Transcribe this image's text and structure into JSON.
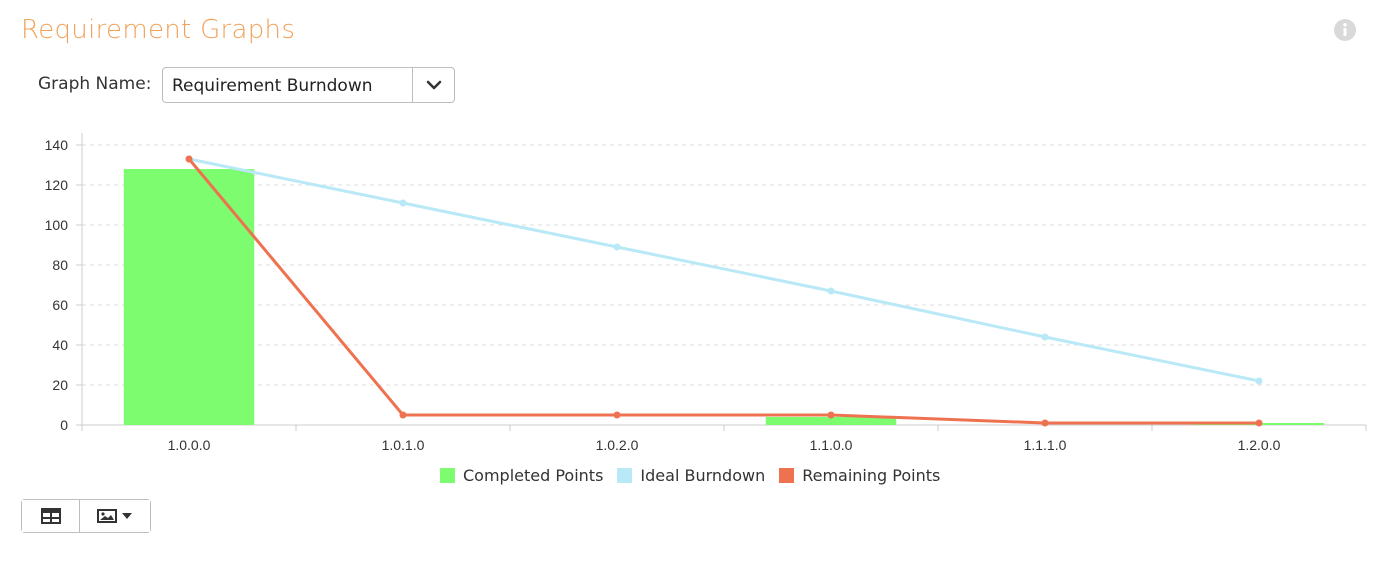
{
  "header": {
    "title": "Requirement Graphs",
    "graph_name_label": "Graph Name:",
    "graph_select_value": "Requirement Burndown"
  },
  "icons": {
    "info": "info-circle-icon",
    "dropdown": "chevron-down-icon",
    "table_view": "table-icon",
    "image_export": "image-icon"
  },
  "chart_data": {
    "type": "bar",
    "categories": [
      "1.0.0.0",
      "1.0.1.0",
      "1.0.2.0",
      "1.1.0.0",
      "1.1.1.0",
      "1.2.0.0"
    ],
    "ylim": [
      0,
      140
    ],
    "yticks": [
      0,
      20,
      40,
      60,
      80,
      100,
      120,
      140
    ],
    "grid": true,
    "legend_position": "bottom",
    "series": [
      {
        "name": "Completed Points",
        "kind": "bar",
        "color": "#7cfc6e",
        "values": [
          128,
          0,
          0,
          4,
          0,
          1
        ]
      },
      {
        "name": "Ideal Burndown",
        "kind": "line",
        "color": "#b9e8f7",
        "values": [
          133,
          111,
          89,
          67,
          44,
          22
        ]
      },
      {
        "name": "Remaining Points",
        "kind": "line",
        "color": "#ee7250",
        "values": [
          133,
          5,
          5,
          5,
          1,
          1
        ]
      }
    ]
  }
}
